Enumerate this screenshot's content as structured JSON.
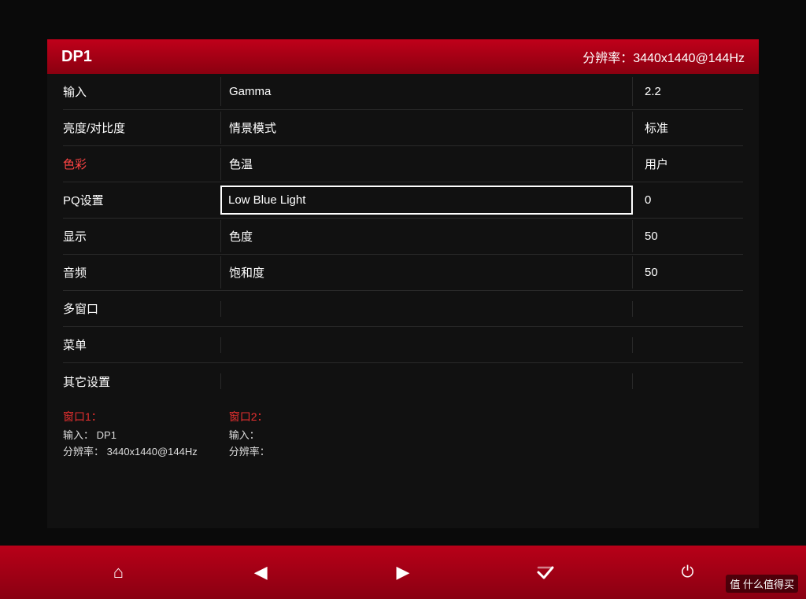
{
  "header": {
    "source": "DP1",
    "resolution_label": "分辨率：",
    "resolution": "3440x1440@144Hz"
  },
  "menu_rows": [
    {
      "left": "输入",
      "mid": "Gamma",
      "right": "2.2",
      "selected": false,
      "left_highlight": false
    },
    {
      "left": "亮度/对比度",
      "mid": "情景模式",
      "right": "标准",
      "selected": false,
      "left_highlight": false
    },
    {
      "left": "色彩",
      "mid": "色温",
      "right": "用户",
      "selected": false,
      "left_highlight": true
    },
    {
      "left": "PQ设置",
      "mid": "Low Blue Light",
      "right": "0",
      "selected": true,
      "left_highlight": false
    },
    {
      "left": "显示",
      "mid": "色度",
      "right": "50",
      "selected": false,
      "left_highlight": false
    },
    {
      "left": "音频",
      "mid": "饱和度",
      "right": "50",
      "selected": false,
      "left_highlight": false
    },
    {
      "left": "多窗口",
      "mid": "",
      "right": "",
      "selected": false,
      "left_highlight": false
    },
    {
      "left": "菜单",
      "mid": "",
      "right": "",
      "selected": false,
      "left_highlight": false
    },
    {
      "left": "其它设置",
      "mid": "",
      "right": "",
      "selected": false,
      "left_highlight": false
    }
  ],
  "window1": {
    "title": "窗口1：",
    "input_label": "输入：",
    "input_value": "DP1",
    "resolution_label": "分辨率：",
    "resolution_value": "3440x1440@144Hz"
  },
  "window2": {
    "title": "窗口2：",
    "input_label": "输入：",
    "input_value": "",
    "resolution_label": "分辨率：",
    "resolution_value": ""
  },
  "nav": {
    "home": "⌂",
    "left": "◀",
    "right": "▶",
    "confirm": "↵",
    "power": "⏻"
  },
  "watermark": "值 什么值得买"
}
